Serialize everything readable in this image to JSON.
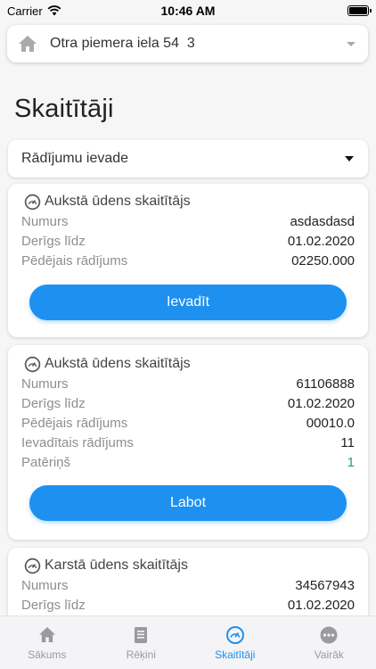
{
  "status_bar": {
    "carrier": "Carrier",
    "time": "10:46 AM"
  },
  "address": {
    "street": "Otra piemera iela 54",
    "apartment": "3"
  },
  "page_title": "Skaitītāji",
  "filter": {
    "selected": "Rādījumu ievade"
  },
  "meters": [
    {
      "title": "Aukstā ūdens skaitītājs",
      "rows": [
        {
          "label": "Numurs",
          "value": "asdasdasd"
        },
        {
          "label": "Derīgs līdz",
          "value": "01.02.2020"
        },
        {
          "label": "Pēdējais rādījums",
          "value": "02250.000"
        }
      ],
      "button": "Ievadīt"
    },
    {
      "title": "Aukstā ūdens skaitītājs",
      "rows": [
        {
          "label": "Numurs",
          "value": "61106888"
        },
        {
          "label": "Derīgs līdz",
          "value": "01.02.2020"
        },
        {
          "label": "Pēdējais rādījums",
          "value": "00010.0"
        },
        {
          "label": "Ievadītais rādījums",
          "value": "11"
        },
        {
          "label": "Patēriņš",
          "value": "1"
        }
      ],
      "button": "Labot"
    },
    {
      "title": "Karstā ūdens skaitītājs",
      "rows": [
        {
          "label": "Numurs",
          "value": "34567943"
        },
        {
          "label": "Derīgs līdz",
          "value": "01.02.2020"
        }
      ]
    }
  ],
  "tabs": [
    {
      "label": "Sākums",
      "icon": "home-icon"
    },
    {
      "label": "Rēķini",
      "icon": "document-icon"
    },
    {
      "label": "Skaitītāji",
      "icon": "gauge-icon",
      "active": true
    },
    {
      "label": "Vairāk",
      "icon": "more-icon"
    }
  ],
  "colors": {
    "accent": "#1e90ef",
    "positive": "#1ea35a"
  }
}
